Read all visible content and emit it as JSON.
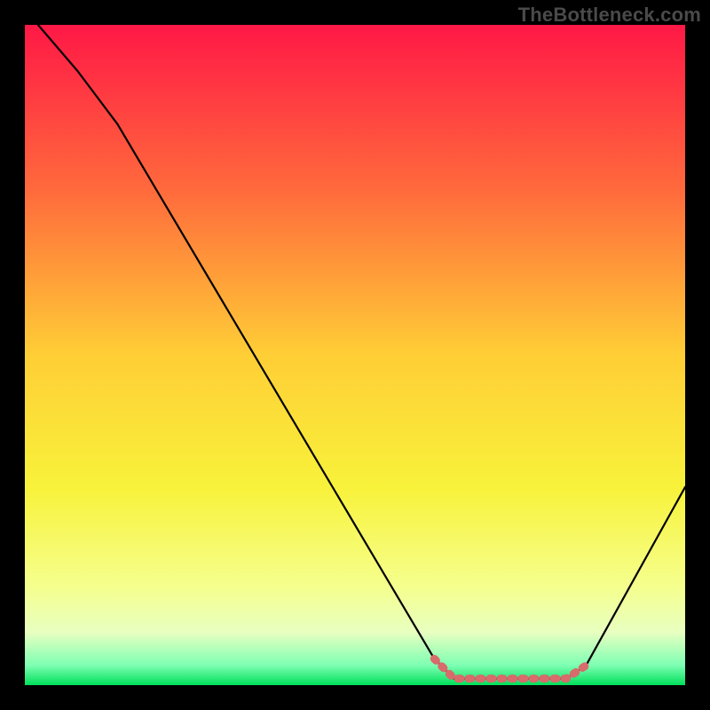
{
  "watermark": "TheBottleneck.com",
  "chart_data": {
    "type": "line",
    "title": "",
    "xlabel": "",
    "ylabel": "",
    "ylim": [
      0,
      100
    ],
    "xlim": [
      0,
      100
    ],
    "gradient_stops": [
      {
        "offset": 0,
        "color": "#ff1846"
      },
      {
        "offset": 25,
        "color": "#ff6a3c"
      },
      {
        "offset": 50,
        "color": "#ffce36"
      },
      {
        "offset": 70,
        "color": "#f8f23a"
      },
      {
        "offset": 85,
        "color": "#f5ff8d"
      },
      {
        "offset": 92,
        "color": "#e8ffc0"
      },
      {
        "offset": 97,
        "color": "#7dffb3"
      },
      {
        "offset": 100,
        "color": "#00e05a"
      }
    ],
    "series": [
      {
        "name": "bottleneck-curve",
        "color": "#000000",
        "points": [
          {
            "x": 2,
            "y": 100
          },
          {
            "x": 8,
            "y": 93
          },
          {
            "x": 14,
            "y": 85
          },
          {
            "x": 62,
            "y": 4
          },
          {
            "x": 65,
            "y": 1
          },
          {
            "x": 82,
            "y": 1
          },
          {
            "x": 85,
            "y": 3
          },
          {
            "x": 100,
            "y": 30
          }
        ]
      },
      {
        "name": "optimal-range-marker",
        "color": "#d86b6b",
        "points": [
          {
            "x": 62,
            "y": 4
          },
          {
            "x": 65,
            "y": 1
          },
          {
            "x": 82,
            "y": 1
          },
          {
            "x": 85,
            "y": 3
          }
        ]
      }
    ]
  }
}
